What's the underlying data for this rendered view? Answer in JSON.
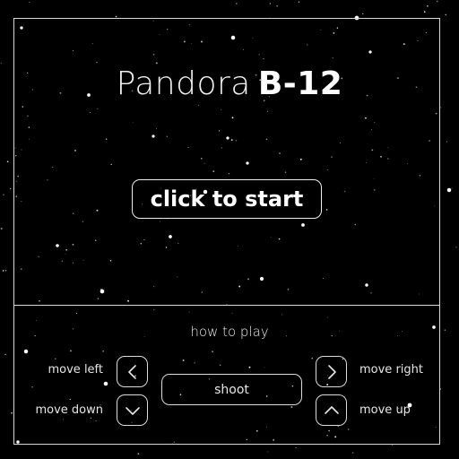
{
  "game": {
    "title_light": "Pandora",
    "title_bold": "B-12",
    "start_label": "click to start"
  },
  "instructions": {
    "heading": "how to play",
    "shoot_label": "shoot",
    "controls": {
      "left": {
        "label": "move left",
        "icon": "chevron-left-icon"
      },
      "down": {
        "label": "move down",
        "icon": "chevron-down-icon"
      },
      "right": {
        "label": "move right",
        "icon": "chevron-right-icon"
      },
      "up": {
        "label": "move up",
        "icon": "chevron-up-icon"
      }
    }
  },
  "colors": {
    "background": "#000000",
    "foreground": "#ffffff",
    "border": "#d8d8d8"
  }
}
